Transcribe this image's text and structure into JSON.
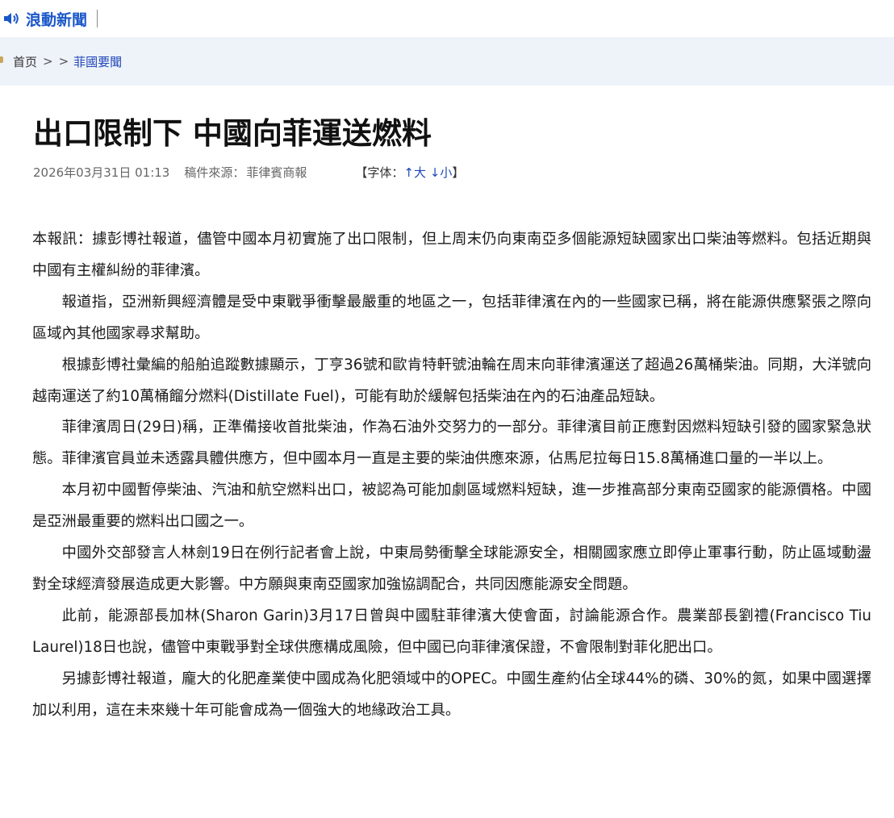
{
  "header": {
    "logo_text": "浪動新聞"
  },
  "breadcrumb": {
    "home": "首页",
    "sep1": ">",
    "sep2": ">",
    "current": "菲國要聞"
  },
  "article": {
    "title": "出口限制下 中國向菲運送燃料",
    "date": "2026年03月31日 01:13",
    "source_label": "稿件來源：",
    "source_name": "菲律賓商報",
    "font_label": "【字体：",
    "font_large": "↑大",
    "font_small": "↓小",
    "font_close": "】",
    "paragraphs": [
      "本報訊：據彭博社報道，儘管中國本月初實施了出口限制，但上周末仍向東南亞多個能源短缺國家出口柴油等燃料。包括近期與中國有主權糾紛的菲律濱。",
      "報道指，亞洲新興經濟體是受中東戰爭衝擊最嚴重的地區之一，包括菲律濱在內的一些國家已稱，將在能源供應緊張之際向區域內其他國家尋求幫助。",
      "根據彭博社彙編的船舶追蹤數據顯示，丁亨36號和歐肯特軒號油輪在周末向菲律濱運送了超過26萬桶柴油。同期，大洋號向越南運送了約10萬桶餾分燃料(Distillate Fuel)，可能有助於緩解包括柴油在內的石油產品短缺。",
      "菲律濱周日(29日)稱，正準備接收首批柴油，作為石油外交努力的一部分。菲律濱目前正應對因燃料短缺引發的國家緊急狀態。菲律濱官員並未透露具體供應方，但中國本月一直是主要的柴油供應來源，佔馬尼拉每日15.8萬桶進口量的一半以上。",
      "本月初中國暫停柴油、汽油和航空燃料出口，被認為可能加劇區域燃料短缺，進一步推高部分東南亞國家的能源價格。中國是亞洲最重要的燃料出口國之一。",
      "中國外交部發言人林劍19日在例行記者會上說，中東局勢衝擊全球能源安全，相關國家應立即停止軍事行動，防止區域動盪對全球經濟發展造成更大影響。中方願與東南亞國家加強協調配合，共同因應能源安全問題。",
      "此前，能源部長加林(Sharon Garin)3月17日曾與中國駐菲律濱大使會面，討論能源合作。農業部長劉禮(Francisco Tiu Laurel)18日也說，儘管中東戰爭對全球供應構成風險，但中國已向菲律濱保證，不會限制對菲化肥出口。",
      "另據彭博社報道，龐大的化肥產業使中國成為化肥領域中的OPEC。中國生產約佔全球44%的磷、30%的氮，如果中國選擇加以利用，這在未來幾十年可能會成為一個強大的地緣政治工具。"
    ]
  },
  "colors": {
    "logo": "#1a57c8",
    "breadcrumb_bg": "#eef2f9",
    "link": "#1f47b8"
  },
  "icons": {
    "logo_icon": "speaker-icon"
  }
}
